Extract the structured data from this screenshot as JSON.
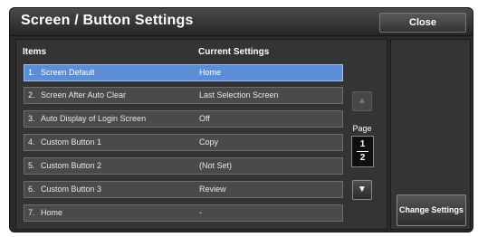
{
  "header": {
    "title": "Screen / Button Settings",
    "close_label": "Close"
  },
  "table": {
    "col_items": "Items",
    "col_settings": "Current Settings",
    "rows": [
      {
        "num": "1.",
        "name": "Screen Default",
        "value": "Home",
        "selected": true
      },
      {
        "num": "2.",
        "name": "Screen After Auto Clear",
        "value": "Last Selection Screen"
      },
      {
        "num": "3.",
        "name": "Auto Display of Login Screen",
        "value": "Off"
      },
      {
        "num": "4.",
        "name": "Custom Button 1",
        "value": "Copy"
      },
      {
        "num": "5.",
        "name": "Custom Button 2",
        "value": "(Not Set)"
      },
      {
        "num": "6.",
        "name": "Custom Button 3",
        "value": "Review"
      },
      {
        "num": "7.",
        "name": "Home",
        "value": "-"
      }
    ]
  },
  "pager": {
    "label": "Page",
    "current": "1",
    "total": "2",
    "up_icon": "triangle-up-icon",
    "down_icon": "triangle-down-icon"
  },
  "actions": {
    "change_label": "Change Settings"
  },
  "colors": {
    "selected_row": "#5b8ed6",
    "panel": "#343434",
    "title_bar": "#2a2a2a"
  }
}
